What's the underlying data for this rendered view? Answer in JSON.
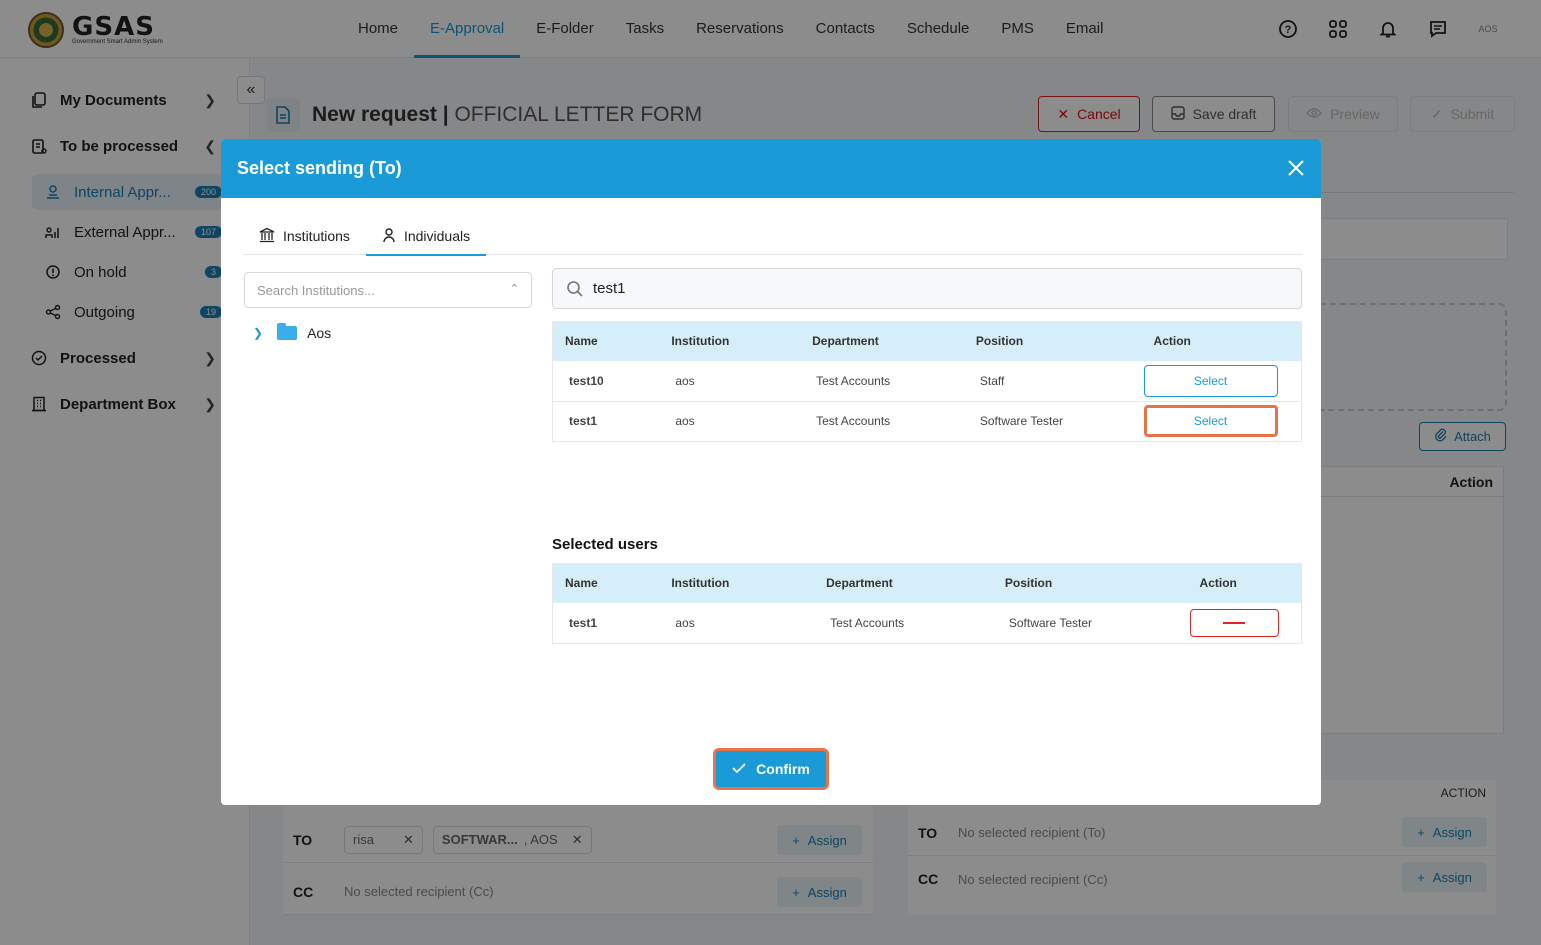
{
  "app": {
    "logo_text": "GSAS",
    "logo_subtitle": "Government Smart Admin System"
  },
  "nav": {
    "items": [
      {
        "label": "Home"
      },
      {
        "label": "E-Approval"
      },
      {
        "label": "E-Folder"
      },
      {
        "label": "Tasks"
      },
      {
        "label": "Reservations"
      },
      {
        "label": "Contacts"
      },
      {
        "label": "Schedule"
      },
      {
        "label": "PMS"
      },
      {
        "label": "Email"
      }
    ],
    "active": "E-Approval",
    "avatar_text": "AOS"
  },
  "sidebar": {
    "my_documents": "My Documents",
    "to_be_processed": "To be processed",
    "internal": {
      "label": "Internal Appr...",
      "count": "200"
    },
    "external": {
      "label": "External Appr...",
      "count": "107"
    },
    "on_hold": {
      "label": "On hold",
      "count": "3"
    },
    "outgoing": {
      "label": "Outgoing",
      "count": "19"
    },
    "processed": "Processed",
    "department_box": "Department Box"
  },
  "page": {
    "title": "New request |",
    "subtitle": "OFFICIAL LETTER FORM",
    "cancel": "Cancel",
    "save_draft": "Save draft",
    "preview": "Preview",
    "submit": "Submit",
    "attach": "Attach",
    "action_col": "Action"
  },
  "recipients": {
    "to_label": "TO",
    "cc_label": "CC",
    "chip1": "risa",
    "chip2_main": "SOFTWAR...",
    "chip2_sub": ", AOS",
    "assign": "Assign",
    "no_cc": "No selected recipient (Cc)",
    "no_to": "No selected recipient (To)",
    "action_header": "ACTION"
  },
  "modal": {
    "title": "Select sending (To)",
    "tabs": [
      {
        "label": "Institutions"
      },
      {
        "label": "Individuals"
      }
    ],
    "active_tab": "Individuals",
    "institution_search_placeholder": "Search Institutions...",
    "tree_root": "Aos",
    "user_search_value": "test1",
    "columns": {
      "name": "Name",
      "institution": "Institution",
      "department": "Department",
      "position": "Position",
      "action": "Action"
    },
    "results": [
      {
        "name": "test10",
        "institution": "aos",
        "department": "Test Accounts",
        "position": "Staff",
        "action": "Select"
      },
      {
        "name": "test1",
        "institution": "aos",
        "department": "Test Accounts",
        "position": "Software Tester",
        "action": "Select"
      }
    ],
    "selected_title": "Selected users",
    "selected": [
      {
        "name": "test1",
        "institution": "aos",
        "department": "Test Accounts",
        "position": "Software Tester"
      }
    ],
    "confirm": "Confirm"
  },
  "colors": {
    "primary": "#1a9ad6",
    "highlight": "#e8734a",
    "danger": "#e02424"
  }
}
